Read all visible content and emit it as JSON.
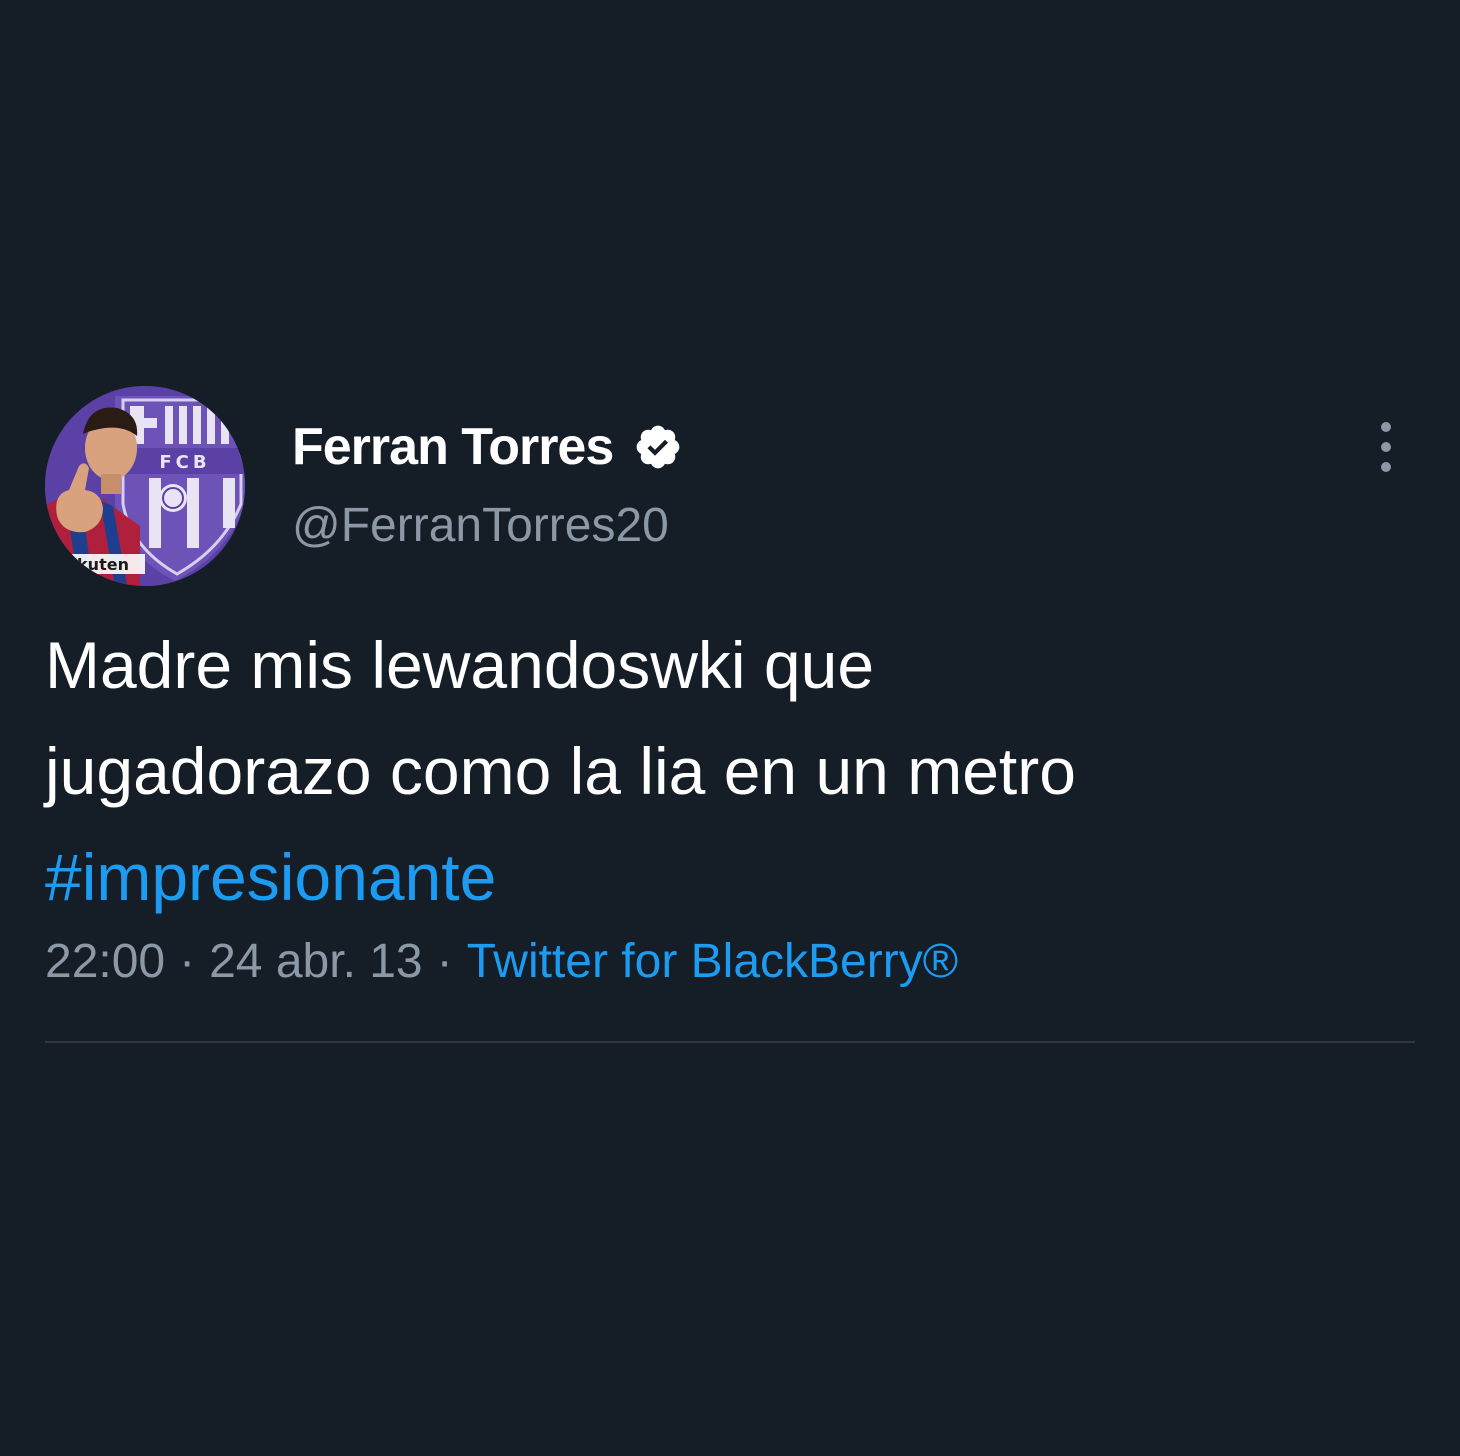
{
  "tweet": {
    "display_name": "Ferran Torres",
    "handle": "@FerranTorres20",
    "verified": true,
    "avatar": {
      "crest_text": "FCB",
      "shirt_text": "kuten"
    },
    "text_lines": [
      "Madre mis lewandoswki que",
      "jugadorazo como la lia en un metro"
    ],
    "hashtag": "#impresionante",
    "time": "22:00",
    "date": "24 abr. 13",
    "separator": "·",
    "source": "Twitter for BlackBerry®"
  },
  "colors": {
    "background": "#151d27",
    "text": "#ffffff",
    "secondary_text": "#8b98a5",
    "accent": "#1d9bf0"
  },
  "icons": {
    "verified": "verified-badge-icon",
    "more": "more-options-icon"
  }
}
